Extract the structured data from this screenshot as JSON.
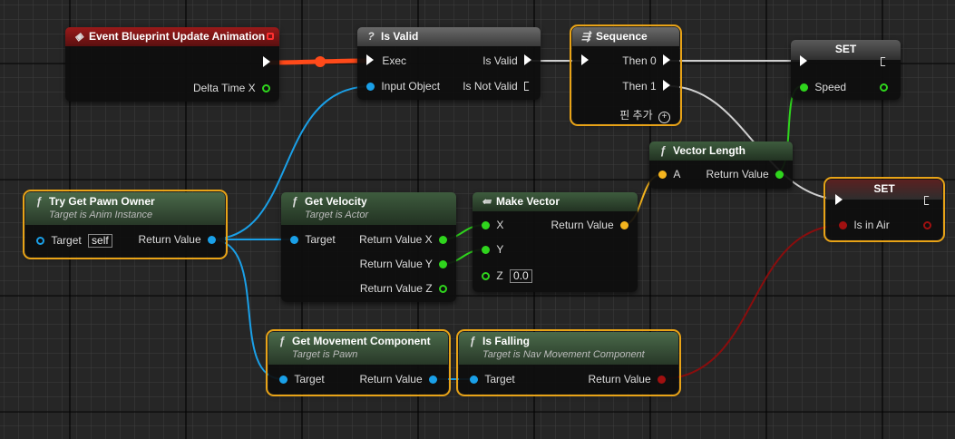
{
  "nodes": {
    "event_update": {
      "title": "Event Blueprint Update Animation",
      "delta_time": "Delta Time X"
    },
    "is_valid": {
      "title": "Is Valid",
      "exec": "Exec",
      "input_object": "Input Object",
      "is_valid": "Is Valid",
      "is_not_valid": "Is Not Valid"
    },
    "sequence": {
      "title": "Sequence",
      "then0": "Then 0",
      "then1": "Then 1",
      "add_pin": "핀 추가"
    },
    "set_speed": {
      "title": "SET",
      "speed": "Speed"
    },
    "vector_length": {
      "title": "Vector Length",
      "a": "A",
      "return_value": "Return Value"
    },
    "set_in_air": {
      "title": "SET",
      "is_in_air": "Is in Air"
    },
    "try_get_pawn_owner": {
      "title": "Try Get Pawn Owner",
      "subtitle": "Target is Anim Instance",
      "target": "Target",
      "target_default": "self",
      "return_value": "Return Value"
    },
    "get_velocity": {
      "title": "Get Velocity",
      "subtitle": "Target is Actor",
      "target": "Target",
      "rx": "Return Value X",
      "ry": "Return Value Y",
      "rz": "Return Value Z"
    },
    "make_vector": {
      "title": "Make Vector",
      "x": "X",
      "y": "Y",
      "z": "Z",
      "z_default": "0.0",
      "return_value": "Return Value"
    },
    "get_movement_component": {
      "title": "Get Movement Component",
      "subtitle": "Target is Pawn",
      "target": "Target",
      "return_value": "Return Value"
    },
    "is_falling": {
      "title": "Is Falling",
      "subtitle": "Target is Nav Movement Component",
      "target": "Target",
      "return_value": "Return Value"
    }
  },
  "colors": {
    "exec": "#ffffff",
    "object": "#1aa0e8",
    "float": "#2fd51d",
    "vector": "#f4b41e",
    "bool": "#a01010",
    "selection": "#e8a317"
  },
  "icons": {
    "event": "event-diamond-icon",
    "is_valid": "question-mark-icon",
    "sequence": "sequence-icon",
    "function": "function-f-icon",
    "make_vector": "make-struct-icon"
  }
}
